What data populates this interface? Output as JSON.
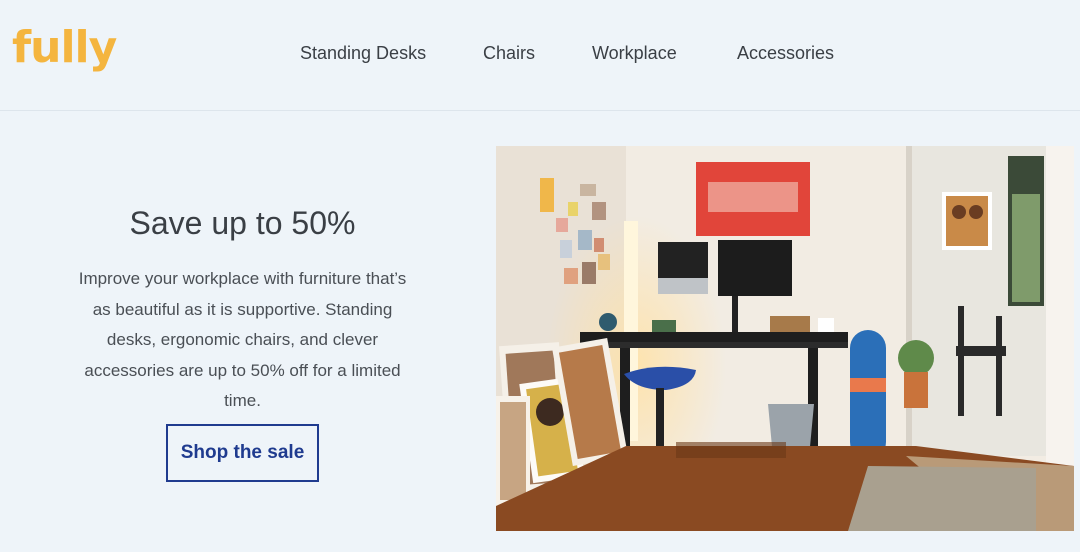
{
  "brand": {
    "logo_text": "fully",
    "color": "#f4b53f"
  },
  "nav": {
    "items": [
      {
        "label": "Standing Desks"
      },
      {
        "label": "Chairs"
      },
      {
        "label": "Workplace"
      },
      {
        "label": "Accessories"
      }
    ]
  },
  "hero": {
    "title": "Save up to 50%",
    "body": "Improve your workplace with furniture that’s as beautiful as it is supportive. Standing desks, ergonomic chairs, and clever accessories are up to 50% off for a limited time.",
    "cta_label": "Shop the sale",
    "cta_color": "#1f3b8f"
  },
  "colors": {
    "background": "#eef4f9",
    "text": "#3a3f45"
  }
}
